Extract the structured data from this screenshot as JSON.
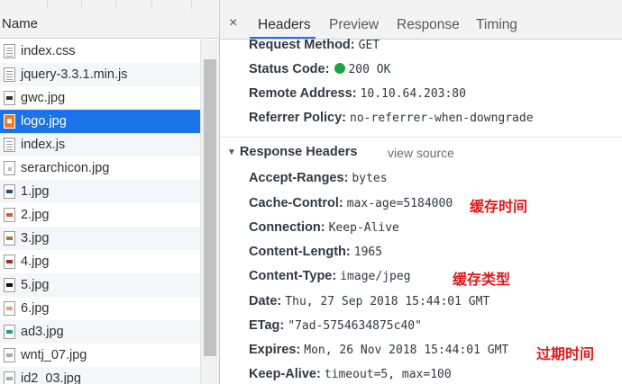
{
  "list": {
    "header": "Name",
    "files": [
      {
        "name": "index.css",
        "icon": "document-icon"
      },
      {
        "name": "jquery-3.3.1.min.js",
        "icon": "document-icon"
      },
      {
        "name": "gwc.jpg",
        "icon": "image-icon"
      },
      {
        "name": "logo.jpg",
        "icon": "image-icon"
      },
      {
        "name": "index.js",
        "icon": "document-icon"
      },
      {
        "name": "serarchicon.jpg",
        "icon": "image-icon"
      },
      {
        "name": "1.jpg",
        "icon": "image-icon"
      },
      {
        "name": "2.jpg",
        "icon": "image-icon"
      },
      {
        "name": "3.jpg",
        "icon": "image-icon"
      },
      {
        "name": "4.jpg",
        "icon": "image-icon"
      },
      {
        "name": "5.jpg",
        "icon": "image-icon"
      },
      {
        "name": "6.jpg",
        "icon": "image-icon"
      },
      {
        "name": "ad3.jpg",
        "icon": "image-icon"
      },
      {
        "name": "wntj_07.jpg",
        "icon": "image-icon"
      },
      {
        "name": "id2_03.jpg",
        "icon": "image-icon"
      }
    ],
    "selected_index": 3
  },
  "tabs": {
    "close_icon": "×",
    "items": [
      "Headers",
      "Preview",
      "Response",
      "Timing"
    ],
    "active": "Headers"
  },
  "general": {
    "request_method": {
      "key": "Request Method:",
      "value": "GET"
    },
    "status_code": {
      "key": "Status Code:",
      "value": "200 OK"
    },
    "remote_address": {
      "key": "Remote Address:",
      "value": "10.10.64.203:80"
    },
    "referrer_policy": {
      "key": "Referrer Policy:",
      "value": "no-referrer-when-downgrade"
    }
  },
  "response_headers": {
    "title": "Response Headers",
    "view_source": "view source",
    "items": [
      {
        "key": "Accept-Ranges:",
        "value": "bytes"
      },
      {
        "key": "Cache-Control:",
        "value": "max-age=5184000"
      },
      {
        "key": "Connection:",
        "value": "Keep-Alive"
      },
      {
        "key": "Content-Length:",
        "value": "1965"
      },
      {
        "key": "Content-Type:",
        "value": "image/jpeg"
      },
      {
        "key": "Date:",
        "value": "Thu, 27 Sep 2018 15:44:01 GMT"
      },
      {
        "key": "ETag:",
        "value": "\"7ad-5754634875c40\""
      },
      {
        "key": "Expires:",
        "value": "Mon, 26 Nov 2018 15:44:01 GMT"
      },
      {
        "key": "Keep-Alive:",
        "value": "timeout=5, max=100"
      }
    ]
  },
  "annotations": {
    "cache_time": "缓存时间",
    "cache_type": "缓存类型",
    "expire_time": "过期时间"
  },
  "colors": {
    "selected_row": "#1a73e8",
    "status_ok": "#1ea446",
    "annotation": "#e0191a"
  }
}
